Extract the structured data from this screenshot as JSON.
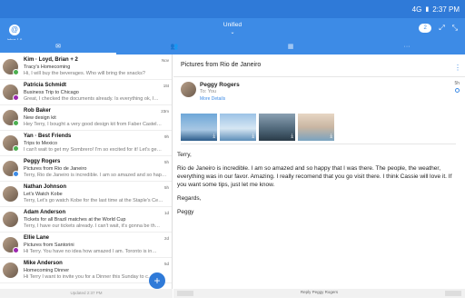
{
  "status": {
    "signal": "4G",
    "time": "2:37 PM"
  },
  "header": {
    "title": "Unified",
    "account_label": "Inbox 1.0",
    "badge": "2"
  },
  "tabs": [
    {
      "icon": "mail-icon"
    },
    {
      "icon": "people-icon"
    },
    {
      "icon": "calendar-icon"
    },
    {
      "icon": "more-icon"
    }
  ],
  "messages": [
    {
      "sender": "Kim · Loyd, Brian + 2",
      "subject": "Tracy's Homecoming",
      "preview": "Hi, I will buy the beverages. Who will bring the snacks?",
      "time": "Nov",
      "dot": "#4caf50"
    },
    {
      "sender": "Patricia Schmidt",
      "subject": "Business Trip to Chicago",
      "preview": "Great, I checked the documents already. Is everything ok, I…",
      "time": "15t",
      "dot": "#9c27b0"
    },
    {
      "sender": "Rob Baker",
      "subject": "New design kit",
      "preview": "Hey Terry, I bought a very good design kit from Faber Castel…",
      "time": "23m",
      "dot": "#4caf50"
    },
    {
      "sender": "Yan · Best Friends",
      "subject": "Trips to Mexico",
      "preview": "I can't wait to get my Sombrero! I'm so excited for it! Let's ge…",
      "time": "9h",
      "dot": "#4caf50"
    },
    {
      "sender": "Peggy Rogers",
      "subject": "Pictures from Rio de Janeiro",
      "preview": "Terry, Rio de Janeiro is incredible. I am so amazed and so hap…",
      "time": "5h",
      "dot": "#3d8be6"
    },
    {
      "sender": "Nathan Johnson",
      "subject": "Let's Watch Kobe",
      "preview": "Terry, Let's go watch Kobe for the last time at the Staple's Ce…",
      "time": "5h",
      "dot": ""
    },
    {
      "sender": "Adam Anderson",
      "subject": "Tickets for all Brazil matches at the World Cup",
      "preview": "Terry, I have our tickets already. I can't wait, it's gonna be th…",
      "time": "1d",
      "dot": ""
    },
    {
      "sender": "Ellie Lane",
      "subject": "Pictures from Santorini",
      "preview": "Hi Terry. You have no idea how amazed I am. Toronto is in…",
      "time": "2d",
      "dot": "#9c27b0"
    },
    {
      "sender": "Mike Anderson",
      "subject": "Homecoming Dinner",
      "preview": "Hi Terry I want to invite you for a Dinner this Sunday to c…",
      "time": "5d",
      "dot": ""
    }
  ],
  "left_footer": "Updated 2:37 PM",
  "detail": {
    "subject": "Pictures from Rio de Janeiro",
    "from": "Peggy Rogers",
    "to": "To: You",
    "more": "More Details",
    "time": "5h",
    "body": [
      "Terry,",
      "Rio de Janeiro is incredible. I am so amazed and so happy that I was there. The people, the weather, everything was in our favor. Amazing. I really recomend that you go visit there. I think Cassie will love it. If you want some tips, just let me know.",
      "Regards,",
      "Peggy"
    ],
    "reply": "Reply Peggy Rogers"
  }
}
